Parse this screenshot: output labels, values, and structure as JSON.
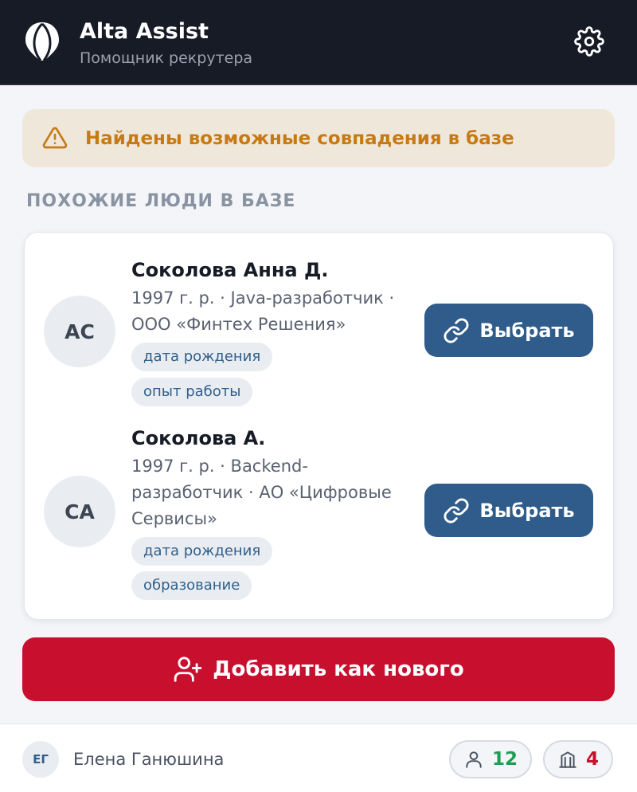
{
  "header": {
    "title": "Alta Assist",
    "subtitle": "Помощник рекрутера",
    "logo_icon": "hot-air-balloon-logo",
    "settings_icon": "gear-icon"
  },
  "alert": {
    "icon": "warning-triangle-icon",
    "text": "Найдены возможные совпадения в базе",
    "color": "#c77a14",
    "background": "#efe7da"
  },
  "section": {
    "title": "ПОХОЖИЕ ЛЮДИ В БАЗЕ"
  },
  "matches": [
    {
      "initials": "АС",
      "name": "Соколова Анна Д.",
      "details": "1997 г. р. · Java-разработчик · ООО «Финтех Решения»",
      "tags": [
        "дата рождения",
        "опыт работы"
      ],
      "button_label": "Выбрать",
      "button_icon": "link-icon"
    },
    {
      "initials": "СА",
      "name": "Соколова А.",
      "details": "1997 г. р. · Backend-разработчик · АО «Цифровые Сервисы»",
      "tags": [
        "дата рождения",
        "образование"
      ],
      "button_label": "Выбрать",
      "button_icon": "link-icon"
    }
  ],
  "add_button": {
    "label": "Добавить как нового",
    "icon": "user-plus-icon",
    "color": "#c8102e"
  },
  "footer": {
    "user_initials": "ЕГ",
    "user_name": "Елена Ганюшина",
    "candidates_count": "12",
    "candidates_icon": "user-icon",
    "candidates_color": "#1f9d55",
    "companies_count": "4",
    "companies_icon": "building-icon",
    "companies_color": "#c8102e"
  },
  "colors": {
    "header_bg": "#161b26",
    "primary_button": "#2f5c8a",
    "tag_text": "#2f5f8c"
  }
}
